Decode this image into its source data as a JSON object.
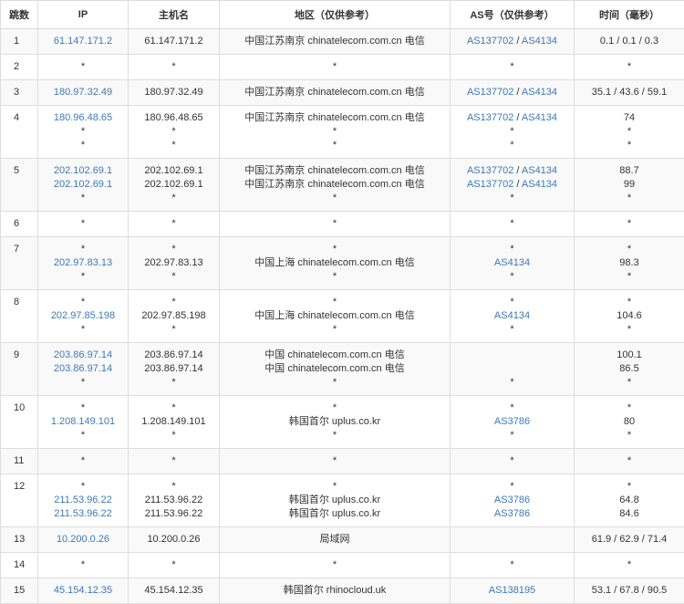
{
  "colors": {
    "link": "#3d79b5",
    "border": "#dddddd",
    "row_alt": "#f9f9f9",
    "text": "#333333"
  },
  "headers": {
    "hop": "跳数",
    "ip": "IP",
    "host": "主机名",
    "region": "地区（仅供参考）",
    "as": "AS号（仅供参考）",
    "time": "时间（毫秒）"
  },
  "rows": [
    {
      "hop": "1",
      "ip": [
        "61.147.171.2"
      ],
      "host": [
        "61.147.171.2"
      ],
      "region": [
        "中国江苏南京 chinatelecom.com.cn 电信"
      ],
      "as": [
        [
          "AS137702",
          "AS4134"
        ]
      ],
      "time": [
        "0.1 / 0.1 / 0.3"
      ]
    },
    {
      "hop": "2",
      "ip": [
        "*"
      ],
      "host": [
        "*"
      ],
      "region": [
        "*"
      ],
      "as": [
        [
          "*"
        ]
      ],
      "time": [
        "*"
      ]
    },
    {
      "hop": "3",
      "ip": [
        "180.97.32.49"
      ],
      "host": [
        "180.97.32.49"
      ],
      "region": [
        "中国江苏南京 chinatelecom.com.cn 电信"
      ],
      "as": [
        [
          "AS137702",
          "AS4134"
        ]
      ],
      "time": [
        "35.1 / 43.6 / 59.1"
      ]
    },
    {
      "hop": "4",
      "ip": [
        "180.96.48.65",
        "*",
        "*"
      ],
      "host": [
        "180.96.48.65",
        "*",
        "*"
      ],
      "region": [
        "中国江苏南京 chinatelecom.com.cn 电信",
        "*",
        "*"
      ],
      "as": [
        [
          "AS137702",
          "AS4134"
        ],
        [
          "*"
        ],
        [
          "*"
        ]
      ],
      "time": [
        "74",
        "*",
        "*"
      ]
    },
    {
      "hop": "5",
      "ip": [
        "202.102.69.1",
        "202.102.69.1",
        "*"
      ],
      "host": [
        "202.102.69.1",
        "202.102.69.1",
        "*"
      ],
      "region": [
        "中国江苏南京 chinatelecom.com.cn 电信",
        "中国江苏南京 chinatelecom.com.cn 电信",
        "*"
      ],
      "as": [
        [
          "AS137702",
          "AS4134"
        ],
        [
          "AS137702",
          "AS4134"
        ],
        [
          "*"
        ]
      ],
      "time": [
        "88.7",
        "99",
        "*"
      ]
    },
    {
      "hop": "6",
      "ip": [
        "*"
      ],
      "host": [
        "*"
      ],
      "region": [
        "*"
      ],
      "as": [
        [
          "*"
        ]
      ],
      "time": [
        "*"
      ]
    },
    {
      "hop": "7",
      "ip": [
        "*",
        "202.97.83.13",
        "*"
      ],
      "host": [
        "*",
        "202.97.83.13",
        "*"
      ],
      "region": [
        "*",
        "中国上海 chinatelecom.com.cn 电信",
        "*"
      ],
      "as": [
        [
          "*"
        ],
        [
          "AS4134"
        ],
        [
          "*"
        ]
      ],
      "time": [
        "*",
        "98.3",
        "*"
      ]
    },
    {
      "hop": "8",
      "ip": [
        "*",
        "202.97.85.198",
        "*"
      ],
      "host": [
        "*",
        "202.97.85.198",
        "*"
      ],
      "region": [
        "*",
        "中国上海 chinatelecom.com.cn 电信",
        "*"
      ],
      "as": [
        [
          "*"
        ],
        [
          "AS4134"
        ],
        [
          "*"
        ]
      ],
      "time": [
        "*",
        "104.6",
        "*"
      ]
    },
    {
      "hop": "9",
      "ip": [
        "203.86.97.14",
        "203.86.97.14",
        "*"
      ],
      "host": [
        "203.86.97.14",
        "203.86.97.14",
        "*"
      ],
      "region": [
        "中国 chinatelecom.com.cn 电信",
        "中国 chinatelecom.com.cn 电信",
        "*"
      ],
      "as": [
        [
          ""
        ],
        [
          ""
        ],
        [
          "*"
        ]
      ],
      "time": [
        "100.1",
        "86.5",
        "*"
      ]
    },
    {
      "hop": "10",
      "ip": [
        "*",
        "1.208.149.101",
        "*"
      ],
      "host": [
        "*",
        "1.208.149.101",
        "*"
      ],
      "region": [
        "*",
        "韩国首尔 uplus.co.kr",
        "*"
      ],
      "as": [
        [
          "*"
        ],
        [
          "AS3786"
        ],
        [
          "*"
        ]
      ],
      "time": [
        "*",
        "80",
        "*"
      ]
    },
    {
      "hop": "11",
      "ip": [
        "*"
      ],
      "host": [
        "*"
      ],
      "region": [
        "*"
      ],
      "as": [
        [
          "*"
        ]
      ],
      "time": [
        "*"
      ]
    },
    {
      "hop": "12",
      "ip": [
        "*",
        "211.53.96.22",
        "211.53.96.22"
      ],
      "host": [
        "*",
        "211.53.96.22",
        "211.53.96.22"
      ],
      "region": [
        "*",
        "韩国首尔 uplus.co.kr",
        "韩国首尔 uplus.co.kr"
      ],
      "as": [
        [
          "*"
        ],
        [
          "AS3786"
        ],
        [
          "AS3786"
        ]
      ],
      "time": [
        "*",
        "64.8",
        "84.6"
      ]
    },
    {
      "hop": "13",
      "ip": [
        "10.200.0.26"
      ],
      "host": [
        "10.200.0.26"
      ],
      "region": [
        "局域网"
      ],
      "as": [
        [
          ""
        ]
      ],
      "time": [
        "61.9 / 62.9 / 71.4"
      ]
    },
    {
      "hop": "14",
      "ip": [
        "*"
      ],
      "host": [
        "*"
      ],
      "region": [
        "*"
      ],
      "as": [
        [
          "*"
        ]
      ],
      "time": [
        "*"
      ]
    },
    {
      "hop": "15",
      "ip": [
        "45.154.12.35"
      ],
      "host": [
        "45.154.12.35"
      ],
      "region": [
        "韩国首尔 rhinocloud.uk"
      ],
      "as": [
        [
          "AS138195"
        ]
      ],
      "time": [
        "53.1 / 67.8 / 90.5"
      ]
    }
  ]
}
